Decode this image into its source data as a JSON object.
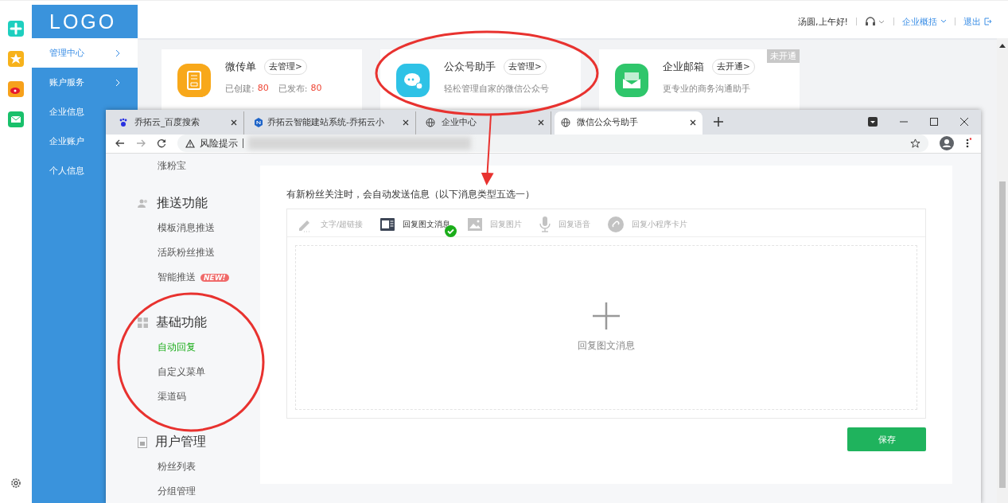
{
  "app": {
    "logo": "LOGO",
    "menu": [
      {
        "label": "管理中心",
        "selected": true,
        "chevron": true
      },
      {
        "label": "账户服务",
        "selected": false,
        "chevron": true
      },
      {
        "label": "企业信息",
        "selected": false,
        "chevron": false
      },
      {
        "label": "企业账户",
        "selected": false,
        "chevron": false
      },
      {
        "label": "个人信息",
        "selected": false,
        "chevron": false
      }
    ]
  },
  "header": {
    "greeting": "汤圆,上午好!",
    "overview": "企业概括",
    "logout": "退出"
  },
  "cards": [
    {
      "title": "微传单",
      "action": "去管理>",
      "stats": [
        {
          "label": "已创建:",
          "value": "80"
        },
        {
          "label": "已发布:",
          "value": "80"
        }
      ]
    },
    {
      "title": "公众号助手",
      "action": "去管理>",
      "description": "轻松管理自家的微信公众号"
    },
    {
      "title": "企业邮箱",
      "action": "去开通>",
      "description": "更专业的商务沟通助手",
      "badge": "未开通"
    }
  ],
  "browser": {
    "tabs": [
      {
        "title": "乔拓云_百度搜索",
        "selected": false
      },
      {
        "title": "乔拓云智能建站系统-乔拓云小",
        "selected": false
      },
      {
        "title": "企业中心",
        "selected": false
      },
      {
        "title": "微信公众号助手",
        "selected": true
      }
    ],
    "address": {
      "warning": "风险提示"
    }
  },
  "nav": {
    "top_item": "涨粉宝",
    "groups": [
      {
        "title": "推送功能",
        "items": [
          {
            "label": "模板消息推送",
            "selected": false
          },
          {
            "label": "活跃粉丝推送",
            "selected": false
          },
          {
            "label": "智能推送",
            "selected": false,
            "badge": "NEW!"
          }
        ]
      },
      {
        "title": "基础功能",
        "items": [
          {
            "label": "自动回复",
            "selected": true
          },
          {
            "label": "自定义菜单",
            "selected": false
          },
          {
            "label": "渠道码",
            "selected": false
          }
        ]
      },
      {
        "title": "用户管理",
        "items": [
          {
            "label": "粉丝列表",
            "selected": false
          },
          {
            "label": "分组管理",
            "selected": false
          }
        ]
      }
    ]
  },
  "panel": {
    "intro": "有新粉丝关注时，会自动发送信息（以下消息类型五选一）",
    "types": [
      {
        "label": "文字/超链接",
        "selected": false
      },
      {
        "label": "回复图文消息",
        "selected": true
      },
      {
        "label": "回复图片",
        "selected": false
      },
      {
        "label": "回复语音",
        "selected": false
      },
      {
        "label": "回复小程序卡片",
        "selected": false
      }
    ],
    "add_label": "回复图文消息",
    "save": "保存"
  }
}
